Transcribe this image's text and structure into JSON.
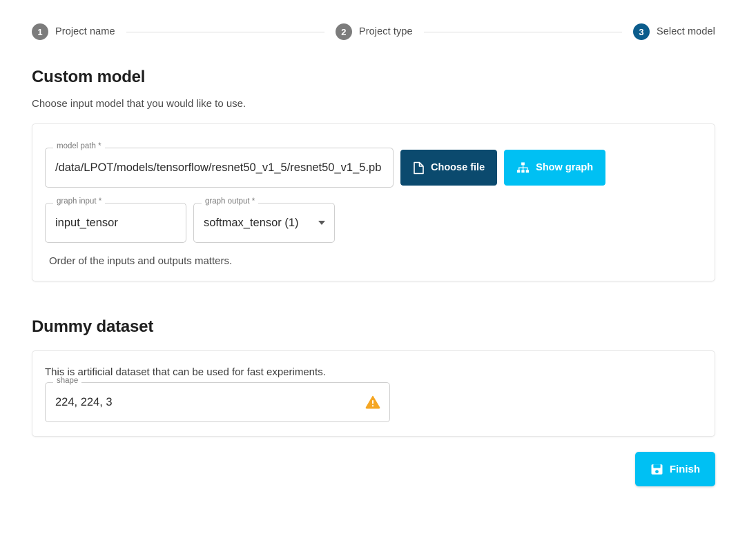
{
  "stepper": {
    "steps": [
      {
        "number": "1",
        "label": "Project name",
        "active": false
      },
      {
        "number": "2",
        "label": "Project type",
        "active": false
      },
      {
        "number": "3",
        "label": "Select model",
        "active": true
      }
    ]
  },
  "custom_model": {
    "title": "Custom model",
    "description": "Choose input model that you would like to use.",
    "model_path": {
      "label": "model path *",
      "value": "/data/LPOT/models/tensorflow/resnet50_v1_5/resnet50_v1_5.pb"
    },
    "choose_file_button": "Choose file",
    "show_graph_button": "Show graph",
    "graph_input": {
      "label": "graph input *",
      "value": "input_tensor"
    },
    "graph_output": {
      "label": "graph output *",
      "value": "softmax_tensor (1)"
    },
    "helper_text": "Order of the inputs and outputs matters."
  },
  "dummy_dataset": {
    "title": "Dummy dataset",
    "description": "This is artificial dataset that can be used for fast experiments.",
    "shape": {
      "label": "shape",
      "value": "224, 224, 3",
      "warning": true
    }
  },
  "footer": {
    "finish_button": "Finish"
  },
  "icons": {
    "choose_file": "file-icon",
    "show_graph": "account-tree-icon",
    "shape_warning": "warning-triangle-icon",
    "finish": "save-icon",
    "graph_output_caret": "chevron-down-icon"
  },
  "colors": {
    "active_step": "#0b5c8c",
    "inactive_step": "#7c7c7c",
    "dark_button": "#0b4a6e",
    "cyan_button": "#00c0f3",
    "warning": "#f5a623"
  }
}
